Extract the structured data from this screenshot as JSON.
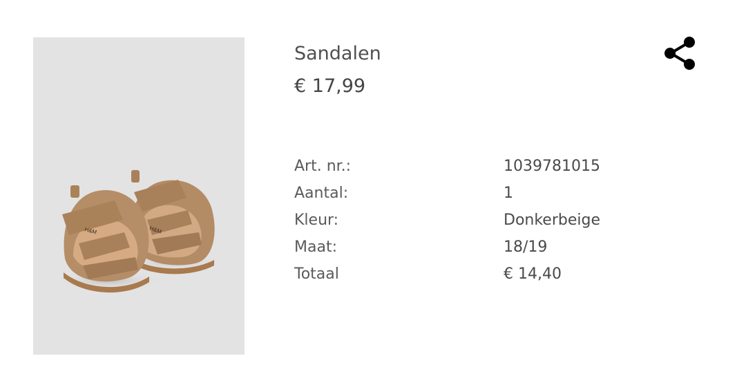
{
  "product": {
    "title": "Sandalen",
    "price": "€ 17,99",
    "image": {
      "icon": "product-photo-sandals",
      "brand_mark": "H&M"
    }
  },
  "share": {
    "icon": "share-icon"
  },
  "details": [
    {
      "label": "Art. nr.:",
      "value": "1039781015"
    },
    {
      "label": "Aantal:",
      "value": "1"
    },
    {
      "label": "Kleur:",
      "value": "Donkerbeige"
    },
    {
      "label": "Maat:",
      "value": "18/19"
    },
    {
      "label": "Totaal",
      "value": "€ 14,40"
    }
  ],
  "colors": {
    "image_background": "#e3e3e4",
    "text": "#555555",
    "icon": "#000000",
    "sandal": "#b8916a"
  }
}
